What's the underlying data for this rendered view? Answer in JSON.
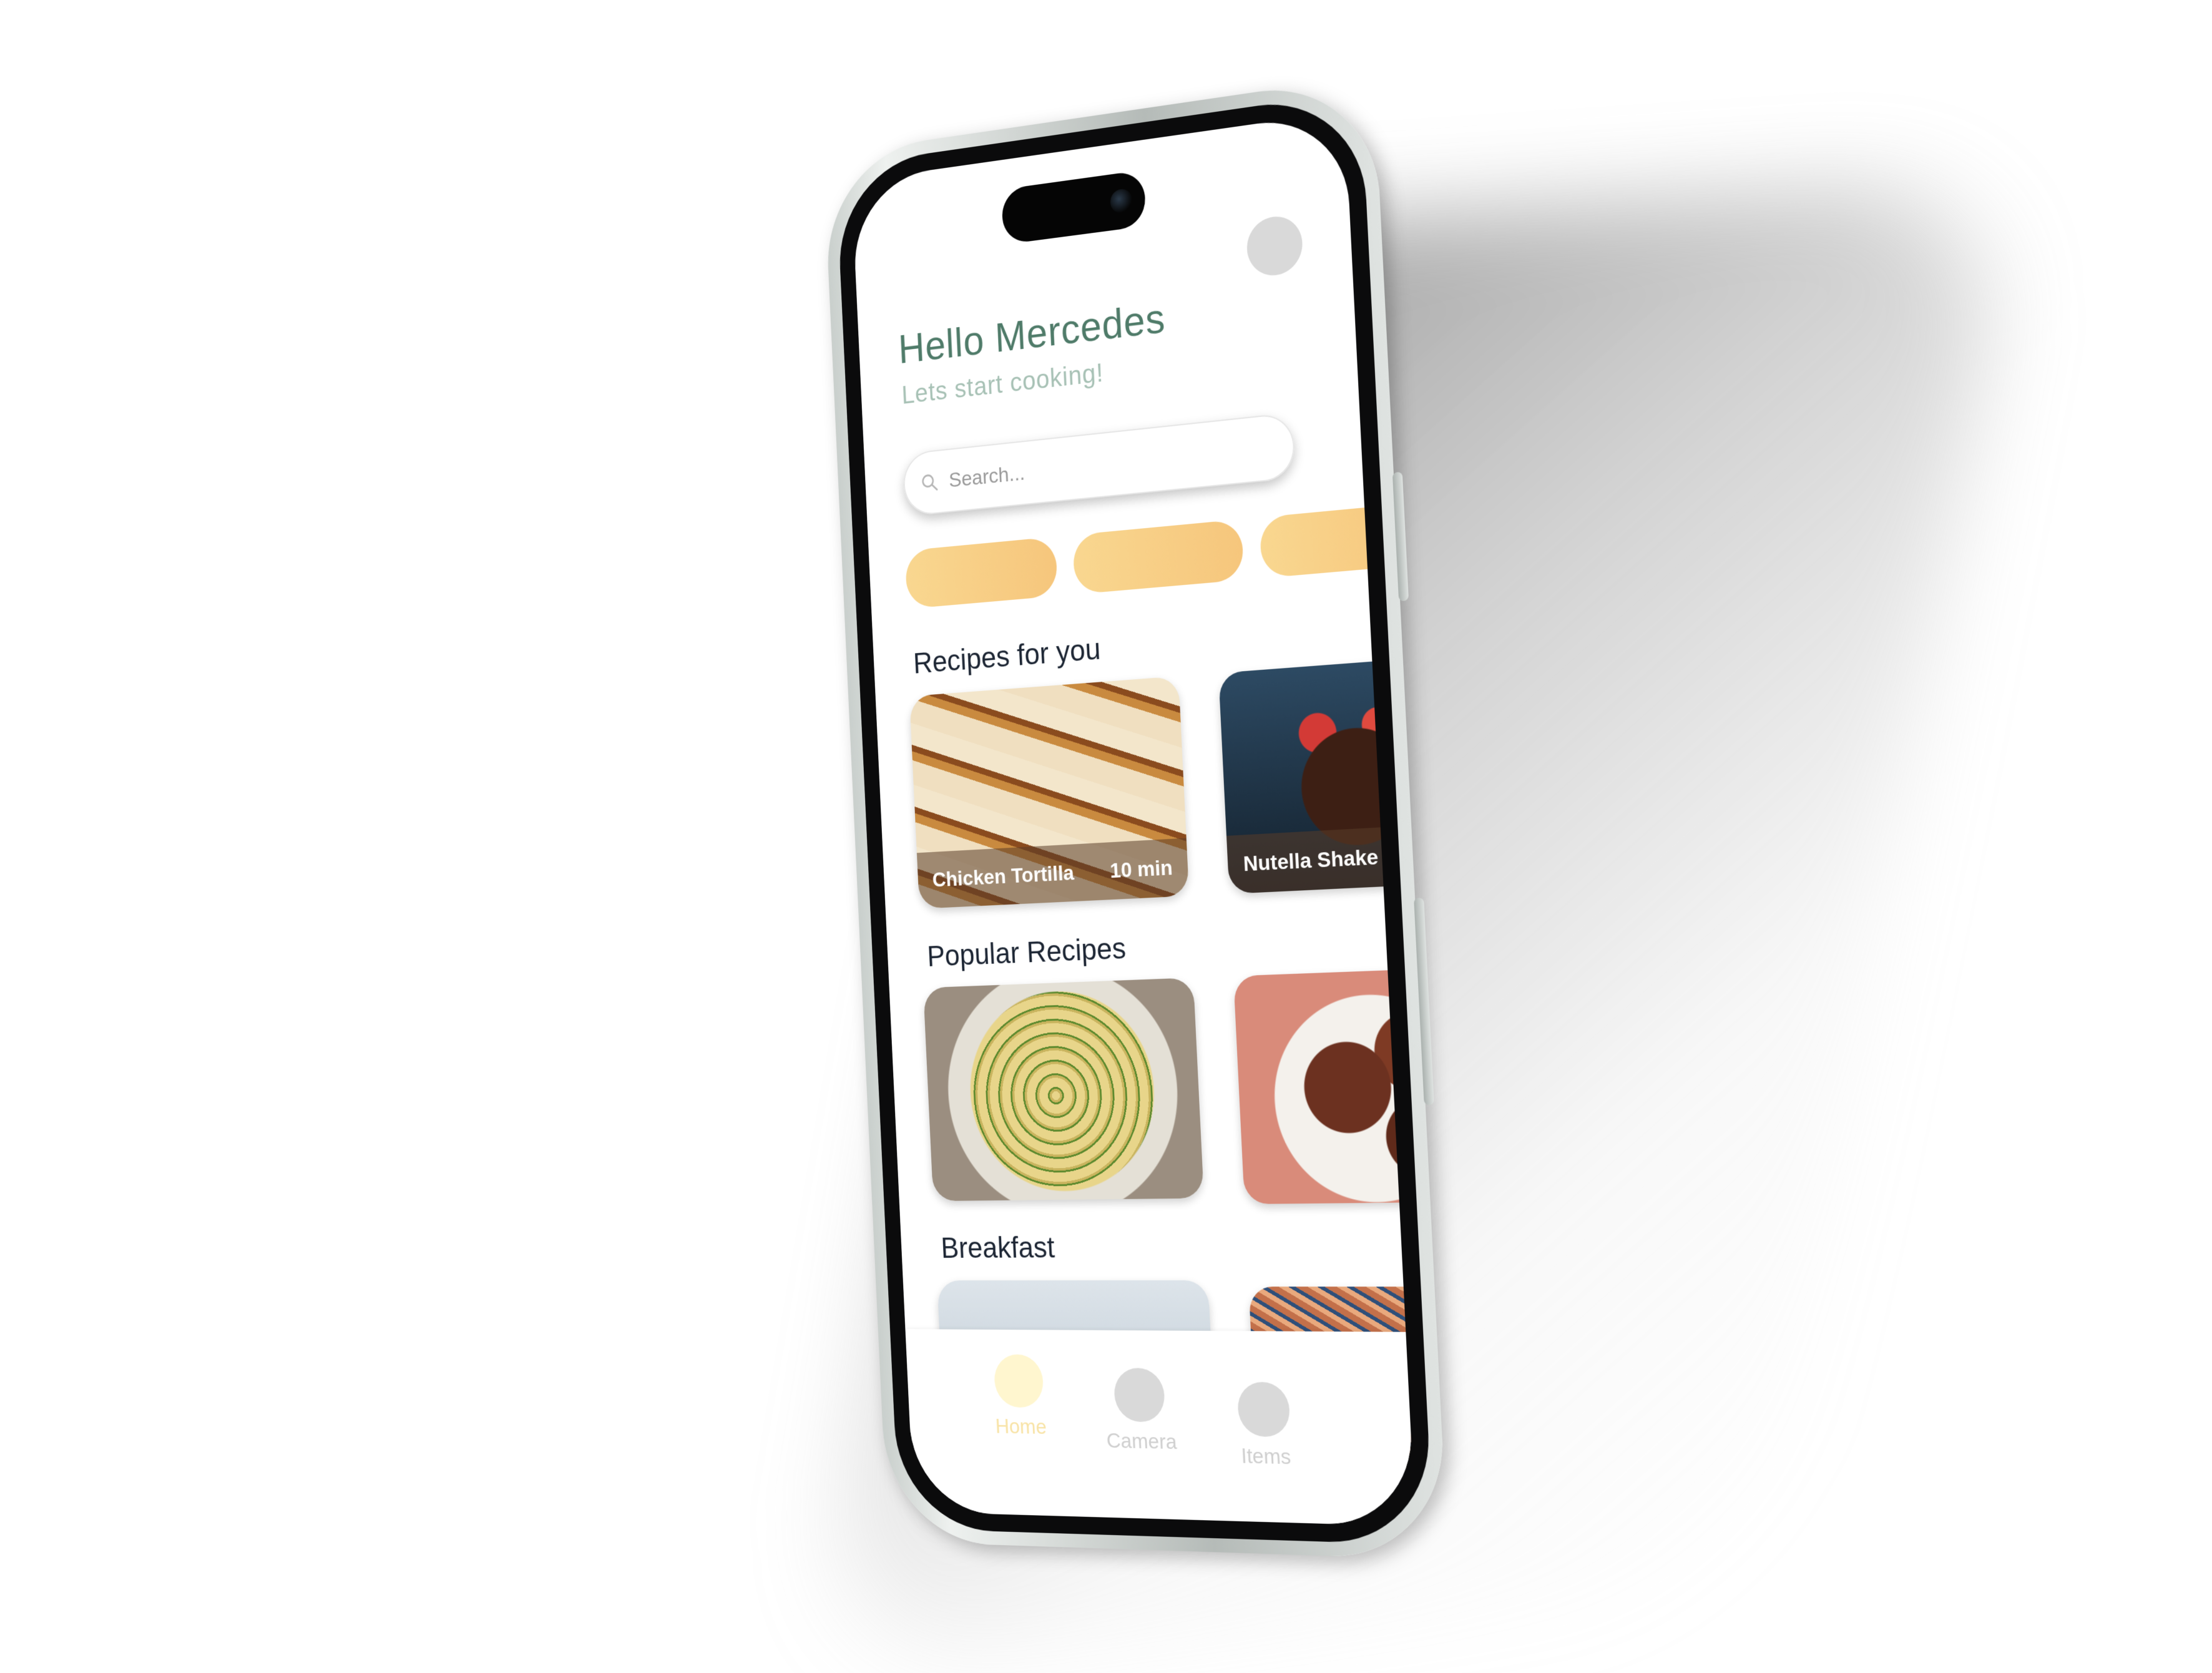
{
  "home": {
    "greeting": "Hello Mercedes",
    "subtitle": "Lets start cooking!"
  },
  "search": {
    "placeholder": "Search..."
  },
  "categories": [
    {
      "label": ""
    },
    {
      "label": ""
    },
    {
      "label": ""
    }
  ],
  "sections": {
    "for_you": {
      "title": "Recipes for you",
      "cards": [
        {
          "name": "Chicken Tortilla",
          "time": "10 min"
        },
        {
          "name": "Nutella Shake",
          "time": ""
        }
      ]
    },
    "popular": {
      "title": "Popular Recipes"
    },
    "breakfast": {
      "title": "Breakfast"
    }
  },
  "tabs": [
    {
      "label": "Home",
      "active": true
    },
    {
      "label": "Camera",
      "active": false
    },
    {
      "label": "Items",
      "active": false
    }
  ],
  "colors": {
    "greeting": "#4f7b69",
    "subtitle": "#a7c1b5",
    "chip": "#f6c67c",
    "tab_active": "#f8e3a6",
    "tab_inactive": "#cfcfcf"
  }
}
